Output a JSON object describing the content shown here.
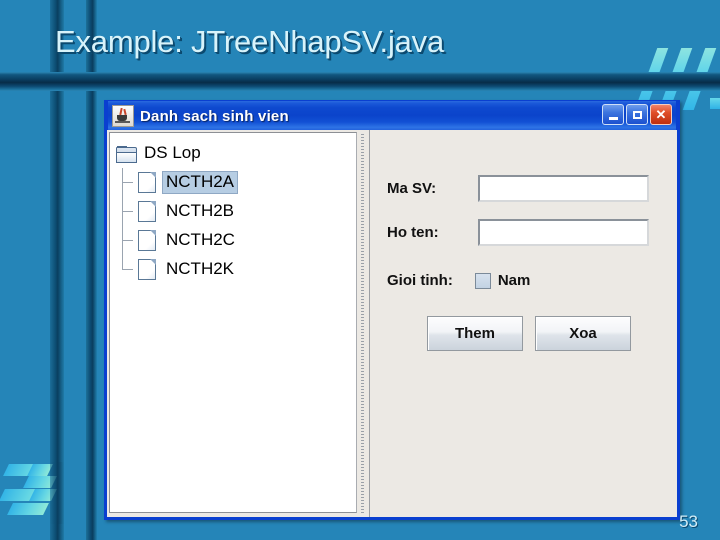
{
  "slide": {
    "title": "Example: JTreeNhapSV.java",
    "page_number": "53",
    "background_color": "#2585b8",
    "title_color": "#d8f3fa",
    "accent_color": "#5fd4ea"
  },
  "window": {
    "title": "Danh sach sinh vien",
    "icon": "java-coffee-cup-icon",
    "titlebar_color": "#0b44cb",
    "border_color": "#0a3fd0",
    "controls": {
      "minimize": "–",
      "maximize": "□",
      "close": "✕"
    }
  },
  "tree": {
    "root": {
      "label": "DS Lop",
      "icon": "open-folder-icon"
    },
    "children": [
      {
        "label": "NCTH2A",
        "icon": "document-icon",
        "selected": true
      },
      {
        "label": "NCTH2B",
        "icon": "document-icon",
        "selected": false
      },
      {
        "label": "NCTH2C",
        "icon": "document-icon",
        "selected": false
      },
      {
        "label": "NCTH2K",
        "icon": "document-icon",
        "selected": false
      }
    ],
    "selection_color": "#b6cde3"
  },
  "form": {
    "ma_sv": {
      "label": "Ma SV:",
      "value": "",
      "placeholder": ""
    },
    "ho_ten": {
      "label": "Ho ten:",
      "value": "",
      "placeholder": ""
    },
    "gioi_tinh": {
      "label": "Gioi tinh:",
      "checkbox_label": "Nam",
      "checked": false
    },
    "buttons": {
      "add": "Them",
      "delete": "Xoa"
    }
  }
}
